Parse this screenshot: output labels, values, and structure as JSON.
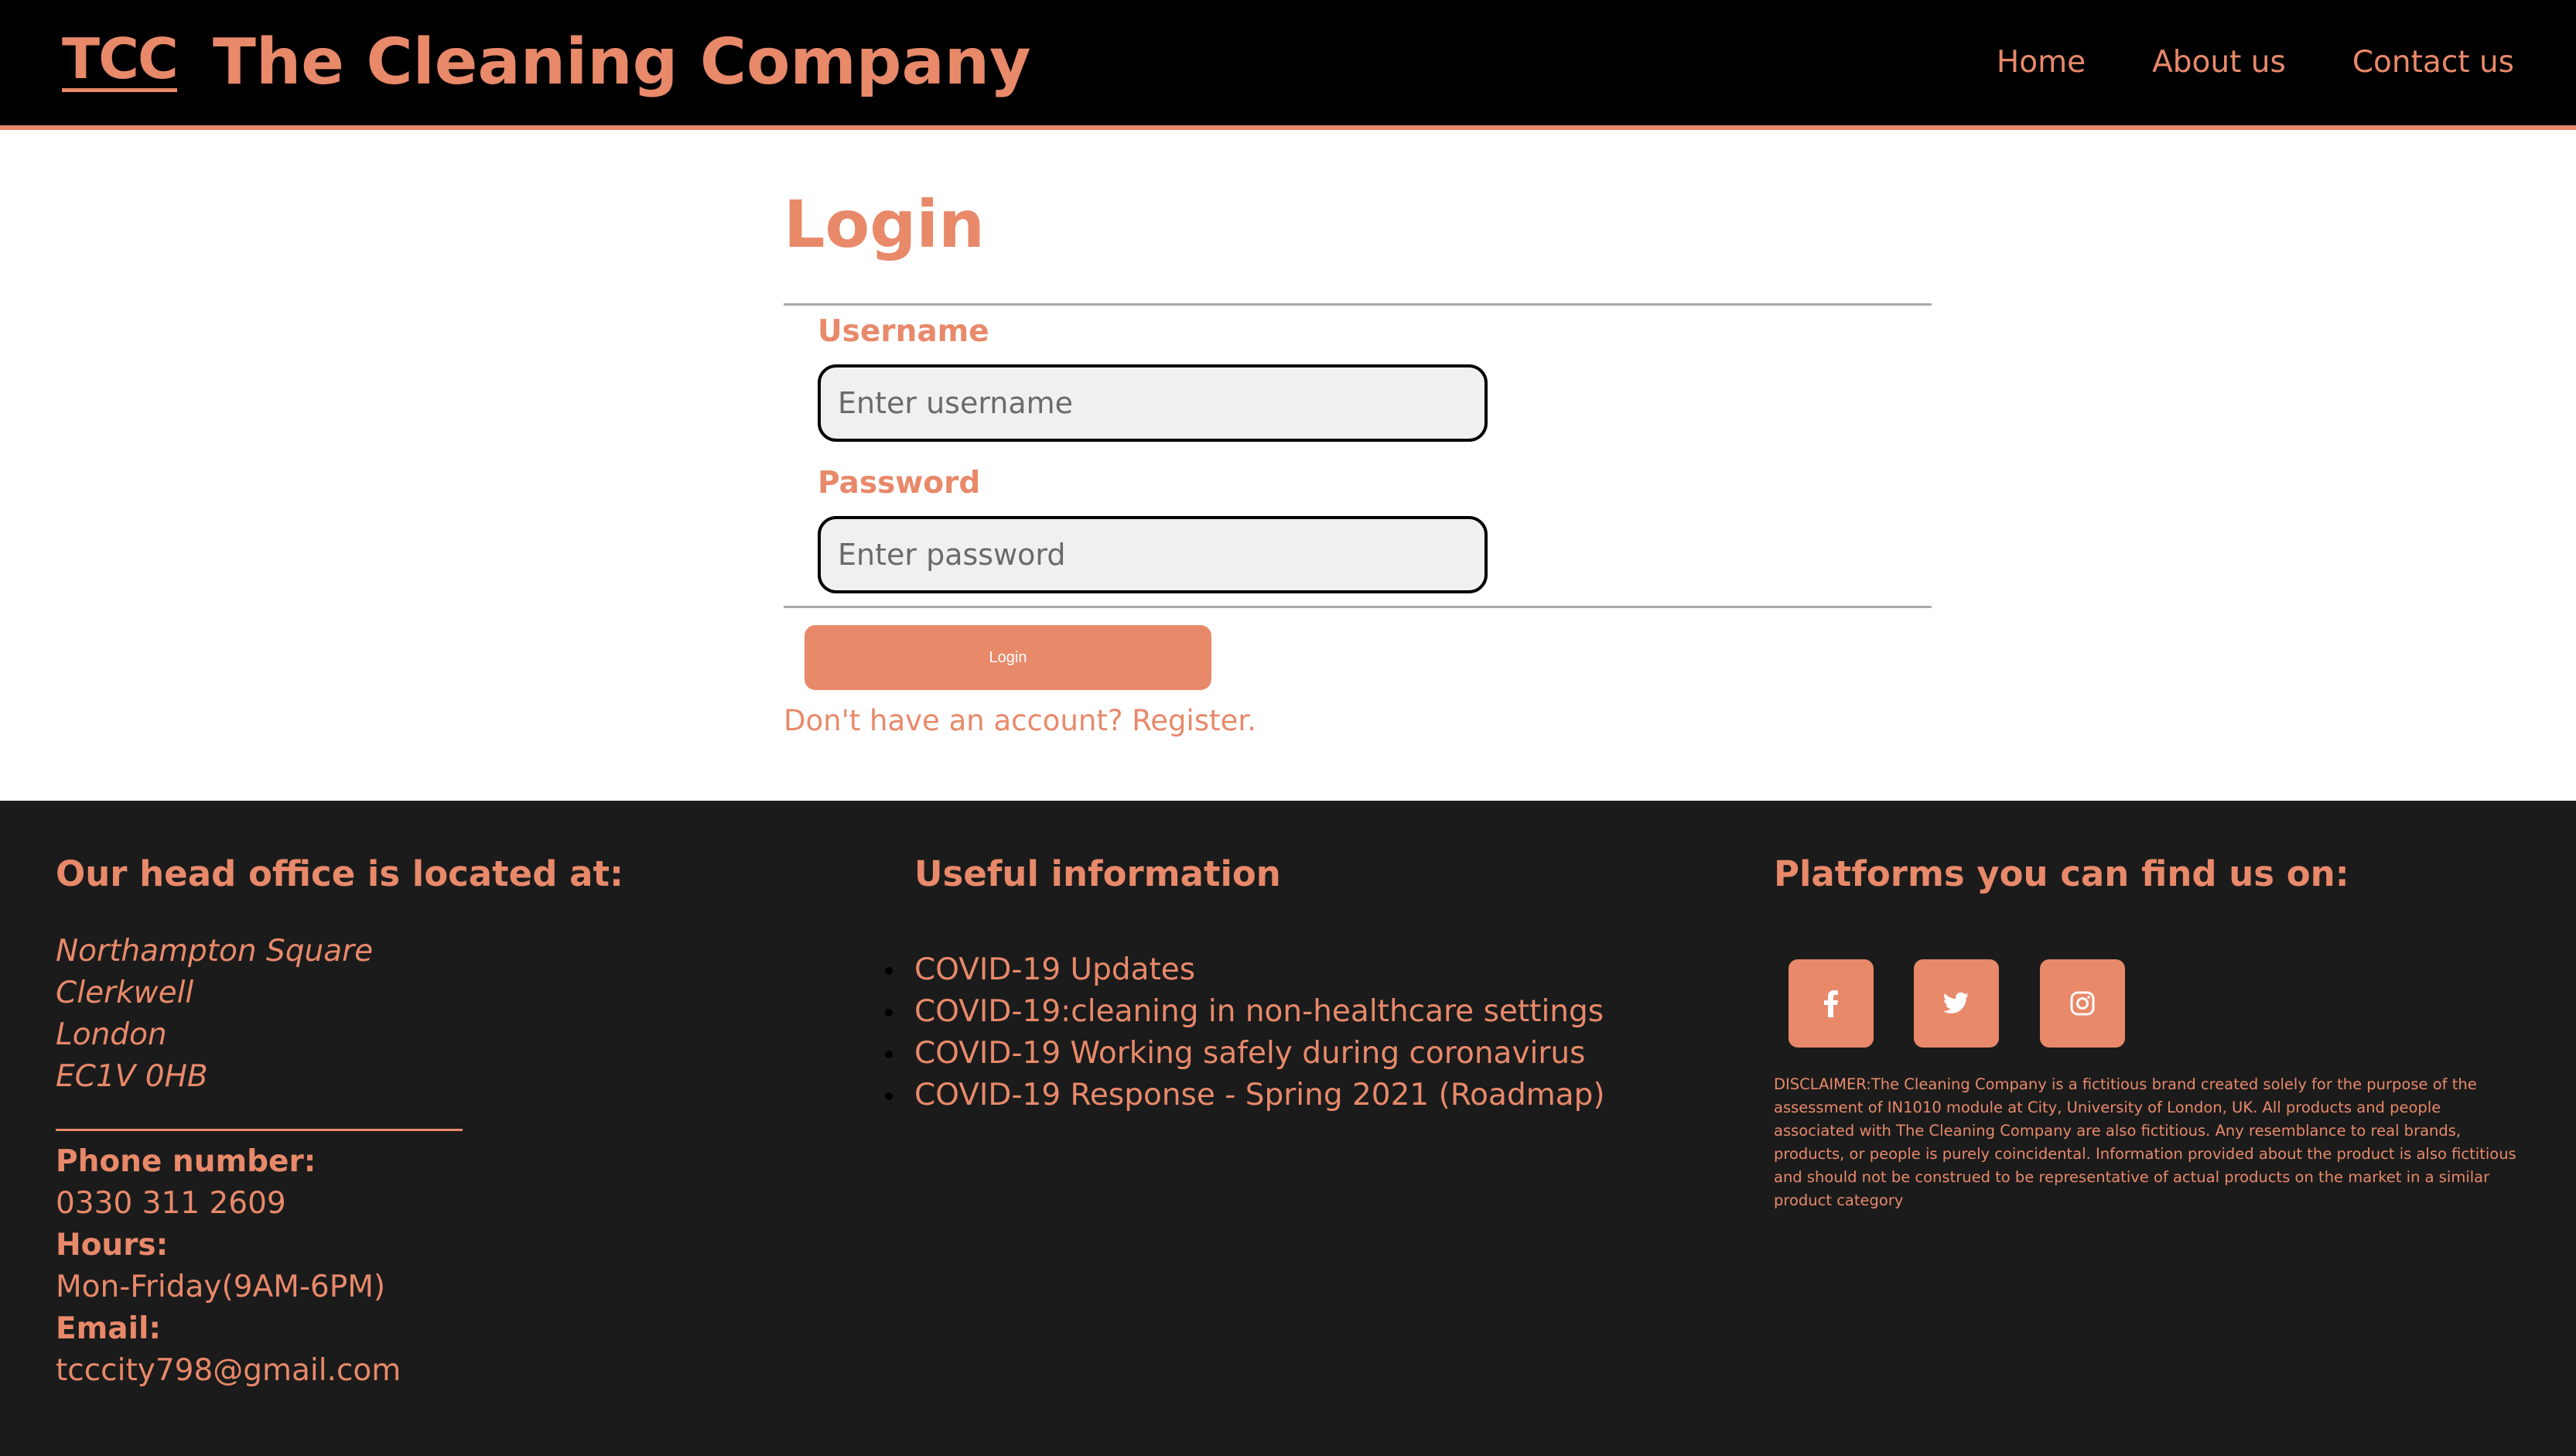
{
  "header": {
    "logo": "TCC",
    "brand": "The Cleaning Company",
    "nav": [
      "Home",
      "About us",
      "Contact us"
    ]
  },
  "login": {
    "title": "Login",
    "username_label": "Username",
    "username_placeholder": "Enter username",
    "password_label": "Password",
    "password_placeholder": "Enter password",
    "button_label": "Login",
    "register_link": "Don't have an account? Register."
  },
  "footer": {
    "office": {
      "heading": "Our head office is located at:",
      "address": [
        "Northampton Square",
        "Clerkwell",
        "London",
        "EC1V 0HB"
      ],
      "phone_label": "Phone number:",
      "phone": "0330 311 2609",
      "hours_label": "Hours:",
      "hours": "Mon-Friday(9AM-6PM)",
      "email_label": "Email:",
      "email": "tcccity798@gmail.com"
    },
    "useful": {
      "heading": "Useful information",
      "links": [
        "COVID-19 Updates",
        "COVID-19:cleaning in non-healthcare settings",
        "COVID-19 Working safely during coronavirus",
        "COVID-19 Response - Spring 2021 (Roadmap)"
      ]
    },
    "platforms": {
      "heading": "Platforms you can find us on:",
      "icons": [
        "facebook-icon",
        "twitter-icon",
        "instagram-icon"
      ],
      "disclaimer": "DISCLAIMER:The Cleaning Company is a fictitious brand created solely for the purpose of the assessment of IN1010 module at City, University of London, UK. All products and people associated with The Cleaning Company are also fictitious. Any resemblance to real brands, products, or people is purely coincidental. Information provided about the product is also fictitious and should not be construed to be representative of actual products on the market in a similar product category"
    }
  },
  "colors": {
    "accent": "#e8896a",
    "header_bg": "#000000",
    "footer_bg": "#1b1b1b",
    "input_bg": "#f0f0f0"
  }
}
